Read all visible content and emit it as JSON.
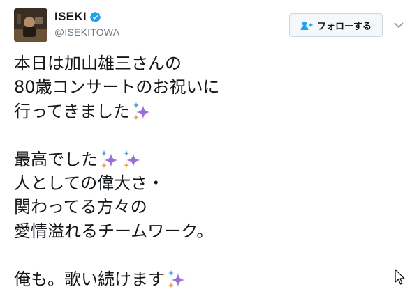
{
  "author": {
    "display_name": "ISEKI",
    "handle": "@ISEKITOWA",
    "avatar_icon": "avatar-photo",
    "verified_icon": "verified-badge-icon"
  },
  "follow_button": {
    "label": "フォローする",
    "icon": "add-person-icon"
  },
  "menu_icon": "chevron-down-icon",
  "tweet_lines": [
    {
      "text": "本日は加山雄三さんの",
      "sparkles": 0
    },
    {
      "text": "80歳コンサートのお祝いに",
      "sparkles": 0
    },
    {
      "text": "行ってきました",
      "sparkles": 1
    },
    {
      "text": "",
      "sparkles": 0
    },
    {
      "text": "最高でした",
      "sparkles": 2
    },
    {
      "text": "人としての偉大さ・",
      "sparkles": 0
    },
    {
      "text": "関わってる方々の",
      "sparkles": 0
    },
    {
      "text": "愛情溢れるチームワーク。",
      "sparkles": 0
    },
    {
      "text": "",
      "sparkles": 0
    },
    {
      "text": "俺も。歌い続けます",
      "sparkles": 1
    }
  ],
  "colors": {
    "verified": "#1da1f2",
    "sparkle_purple": "#9b6dd6",
    "sparkle_orange": "#f4a340",
    "sparkle_blue": "#4aa3df"
  }
}
